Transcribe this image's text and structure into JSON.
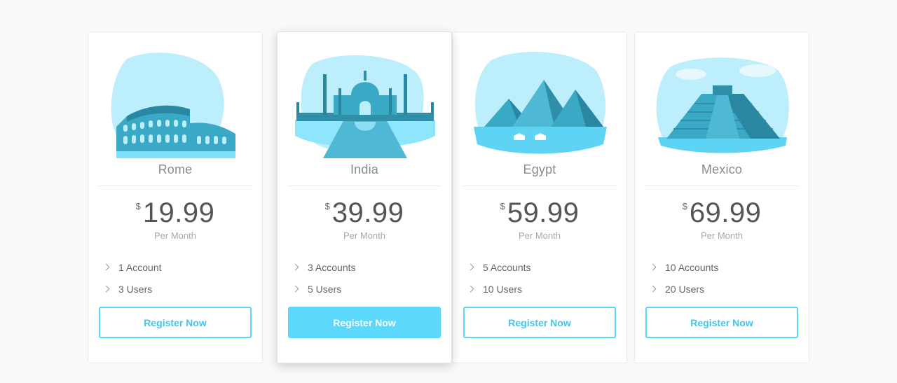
{
  "plans": [
    {
      "place": "Rome",
      "currency": "$",
      "price": "19.99",
      "period": "Per Month",
      "features": [
        "1 Account",
        "3 Users"
      ],
      "button": "Register Now",
      "illustration": "colosseum-illustration"
    },
    {
      "place": "India",
      "currency": "$",
      "price": "39.99",
      "period": "Per Month",
      "features": [
        "3 Accounts",
        "5 Users"
      ],
      "button": "Register Now",
      "illustration": "taj-mahal-illustration"
    },
    {
      "place": "Egypt",
      "currency": "$",
      "price": "59.99",
      "period": "Per Month",
      "features": [
        "5 Accounts",
        "10 Users"
      ],
      "button": "Register Now",
      "illustration": "pyramids-illustration"
    },
    {
      "place": "Mexico",
      "currency": "$",
      "price": "69.99",
      "period": "Per Month",
      "features": [
        "10 Accounts",
        "20 Users"
      ],
      "button": "Register Now",
      "illustration": "mayan-pyramid-illustration"
    }
  ],
  "colors": {
    "accent": "#5cd8fa",
    "accent_text": "#3fc6ee",
    "illustration_light": "#bdeefb",
    "illustration_dark": "#2f8fa8"
  }
}
